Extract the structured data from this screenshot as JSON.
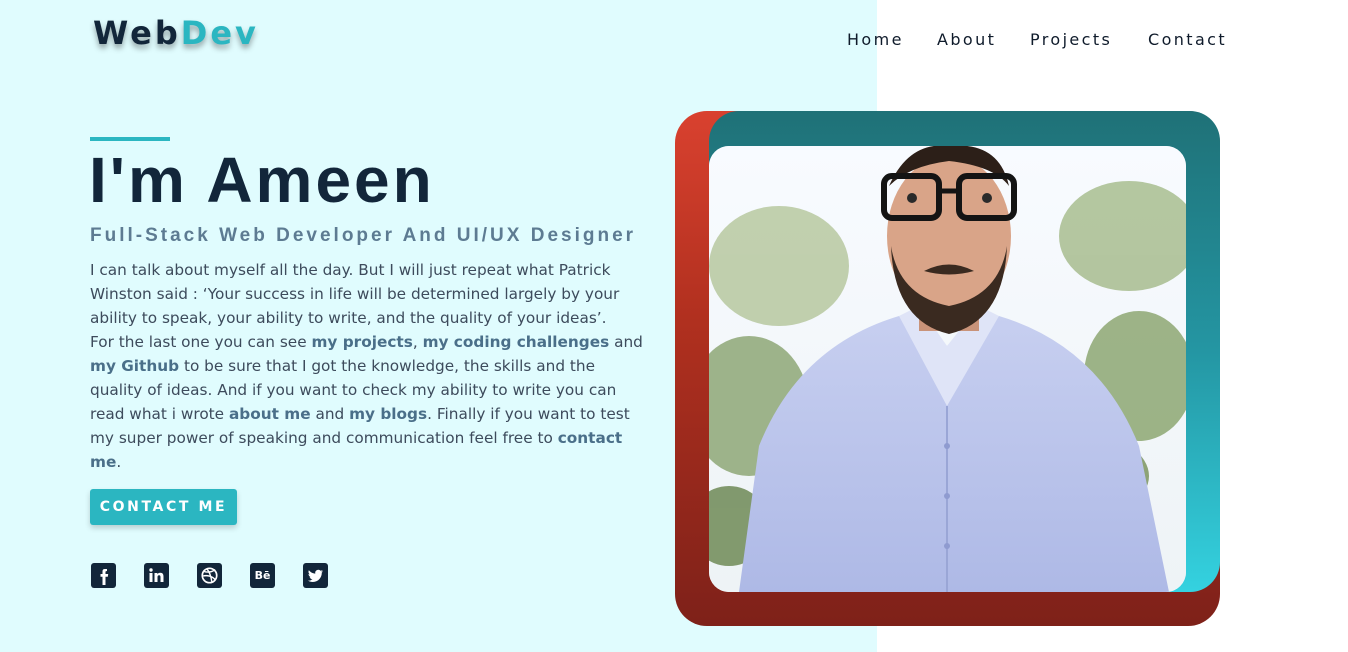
{
  "logo": {
    "part1": "Web",
    "part2": "Dev"
  },
  "nav": {
    "items": [
      {
        "label": "Home"
      },
      {
        "label": "About"
      },
      {
        "label": "Projects"
      },
      {
        "label": "Contact"
      }
    ]
  },
  "hero": {
    "title": "I'm Ameen",
    "subtitle": "Full-Stack Web Developer And UI/UX Designer",
    "bio": {
      "p1": "I can talk about myself all the day. But I will just repeat what Patrick Winston said : ‘Your success in life will be determined largely by your ability to speak, your ability to write, and the quality of your ideas’.",
      "p2_a": "For the last one you can see ",
      "link_projects": "my projects",
      "sep1": ", ",
      "link_challenges": "my coding challenges",
      "p2_b": " and ",
      "link_github": "my Github",
      "p2_c": " to be sure that I got the knowledge, the skills and the quality of ideas. And if you want to check my ability to write you can read what i wrote ",
      "link_about": "about me",
      "p2_d": " and ",
      "link_blogs": "my blogs",
      "p2_e": ". Finally if you want to test my super power of speaking and communication feel free to ",
      "link_contact": "contact me",
      "p2_f": "."
    },
    "cta_label": "CONTACT ME"
  },
  "social": [
    {
      "icon": "facebook-icon",
      "glyph": "f"
    },
    {
      "icon": "linkedin-icon",
      "glyph": "in"
    },
    {
      "icon": "dribbble-icon",
      "glyph": ""
    },
    {
      "icon": "behance-icon",
      "glyph": "Bē"
    },
    {
      "icon": "twitter-icon",
      "glyph": ""
    }
  ],
  "colors": {
    "accent": "#2bb6c1",
    "navy": "#12263a",
    "left_background": "#e0fcfe",
    "frame_red": "#b1301f",
    "frame_teal": "#2496a3"
  }
}
